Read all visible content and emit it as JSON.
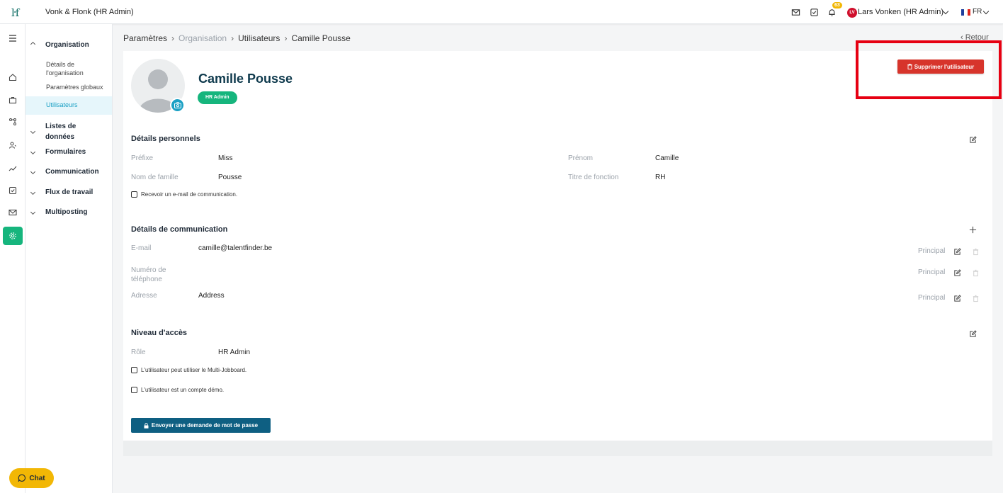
{
  "header": {
    "logo": "ŀf",
    "company": "Vonk & Flonk (HR Admin)",
    "notification_count": "63",
    "user_initials": "LV",
    "user_name": "Lars Vonken (HR Admin)",
    "language": "FR",
    "flag_colors": [
      "#1f3f9e",
      "#ffffff",
      "#e1251b"
    ]
  },
  "rail": {
    "items": [
      "menu-icon",
      "home-icon",
      "briefcase-icon",
      "workflow-icon",
      "users-icon",
      "analytics-icon",
      "tasks-icon",
      "mail-icon",
      "settings-icon"
    ],
    "active": "settings-icon"
  },
  "sidebar": {
    "organisation": "Organisation",
    "org_details": "Détails de l'organisation",
    "global_params": "Paramètres globaux",
    "users": "Utilisateurs",
    "data_lists": "Listes de données",
    "forms": "Formulaires",
    "communication": "Communication",
    "workflow": "Flux de travail",
    "multiposting": "Multiposting"
  },
  "breadcrumb": {
    "item1": "Paramètres",
    "item2": "Organisation",
    "item3": "Utilisateurs",
    "item4": "Camille Pousse",
    "back": "Retour"
  },
  "profile": {
    "name": "Camille Pousse",
    "role_badge": "HR Admin",
    "delete_button": "Supprimer l'utilisateur"
  },
  "personal": {
    "title": "Détails personnels",
    "prefix_label": "Préfixe",
    "prefix_value": "Miss",
    "firstname_label": "Prénom",
    "firstname_value": "Camille",
    "lastname_label": "Nom de famille",
    "lastname_value": "Pousse",
    "jobtitle_label": "Titre de fonction",
    "jobtitle_value": "RH",
    "receive_email": "Recevoir un e-mail de communication."
  },
  "communication": {
    "title": "Détails de communication",
    "email_label": "E-mail",
    "email_value": "camille@talentfinder.be",
    "phone_label": "Numéro de téléphone",
    "phone_value": "",
    "address_label": "Adresse",
    "address_value": "Address",
    "principal": "Principal"
  },
  "access": {
    "title": "Niveau d'accès",
    "role_label": "Rôle",
    "role_value": "HR Admin",
    "multi_jobboard": "L'utilisateur peut utiliser le Multi-Jobboard.",
    "demo_account": "L'utilisateur est un compte démo.",
    "password_button": "Envoyer une demande de mot de passe"
  },
  "chat": {
    "label": "Chat"
  },
  "colors": {
    "accent_green": "#16b57d",
    "accent_blue": "#1aa0c4",
    "delete_red": "#d7342b",
    "highlight_red": "#e60012",
    "primary_dark": "#0e5f82",
    "chat_yellow": "#f2b705"
  }
}
